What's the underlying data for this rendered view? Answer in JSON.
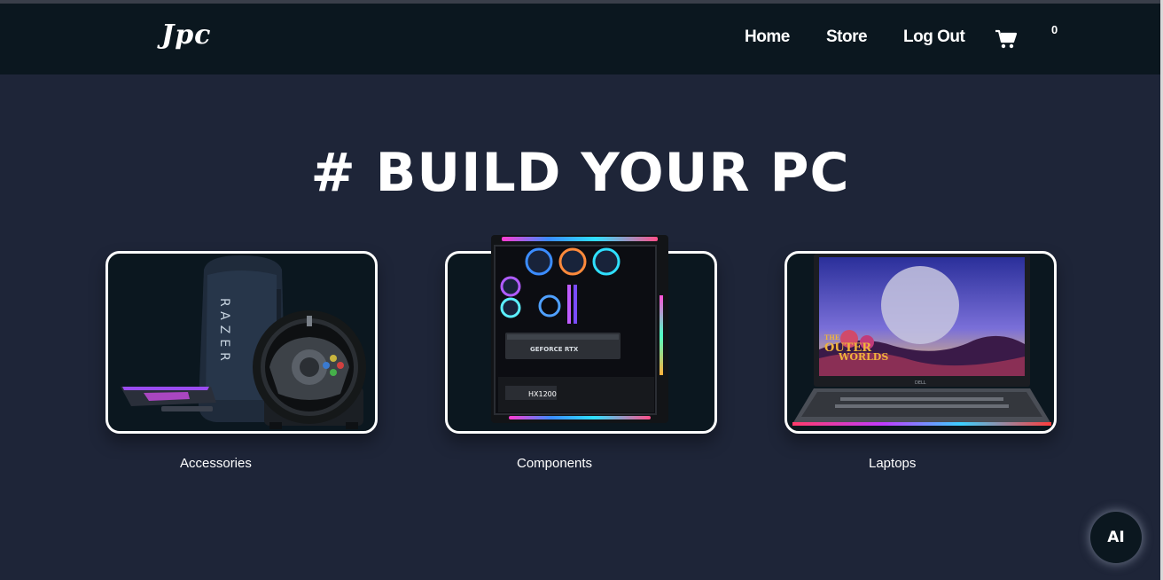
{
  "nav": {
    "logo": "Jpc",
    "links": [
      "Home",
      "Store",
      "Log Out"
    ],
    "cart_count": "0"
  },
  "hero": {
    "title": "# BUILD YOUR PC"
  },
  "categories": [
    {
      "label": "Accessories",
      "icon": "accessories-image"
    },
    {
      "label": "Components",
      "icon": "pc-case-image"
    },
    {
      "label": "Laptops",
      "icon": "laptop-image"
    }
  ],
  "product_text": {
    "razer": "RAZER",
    "gpu": "GEFORCE RTX",
    "psu": "HX1200",
    "game_line1": "THE",
    "game_line2": "OUTER",
    "game_line3": "WORLDS",
    "laptop_brand": "DELL"
  },
  "ai_button": {
    "label": "AI"
  },
  "colors": {
    "page_bg": "#1e2538",
    "navbar_bg": "#0b171f",
    "card_bg": "#0b171f",
    "text": "#ffffff"
  }
}
